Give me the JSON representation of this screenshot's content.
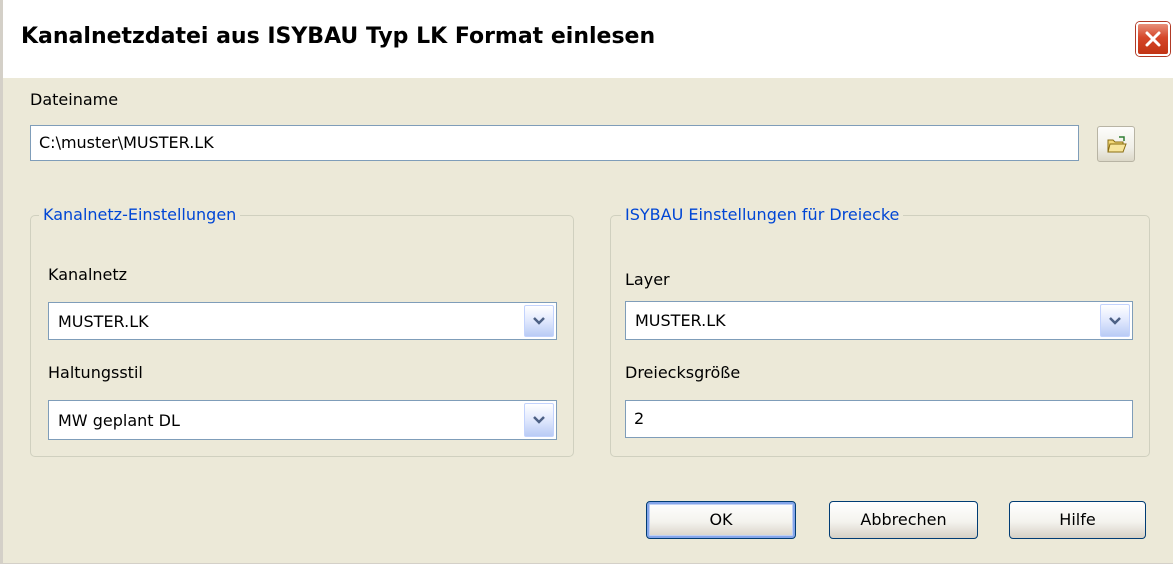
{
  "window": {
    "title": "Kanalnetzdatei aus ISYBAU Typ LK Format einlesen"
  },
  "file": {
    "label": "Dateiname",
    "value": "C:\\muster\\MUSTER.LK"
  },
  "group_left": {
    "title": "Kanalnetz-Einstellungen",
    "kanalnetz_label": "Kanalnetz",
    "kanalnetz_value": "MUSTER.LK",
    "haltungsstil_label": "Haltungsstil",
    "haltungsstil_value": "MW geplant DL"
  },
  "group_right": {
    "title": "ISYBAU Einstellungen für Dreiecke",
    "layer_label": "Layer",
    "layer_value": "MUSTER.LK",
    "size_label": "Dreiecksgröße",
    "size_value": "2"
  },
  "buttons": {
    "ok": "OK",
    "cancel": "Abbrechen",
    "help": "Hilfe"
  },
  "icons": {
    "close": "close-icon",
    "browse": "folder-open-icon",
    "dropdown": "chevron-down-icon"
  },
  "colors": {
    "dialog_bg": "#ece9d8",
    "group_title": "#0046d5",
    "close_button": "#d5462a"
  }
}
